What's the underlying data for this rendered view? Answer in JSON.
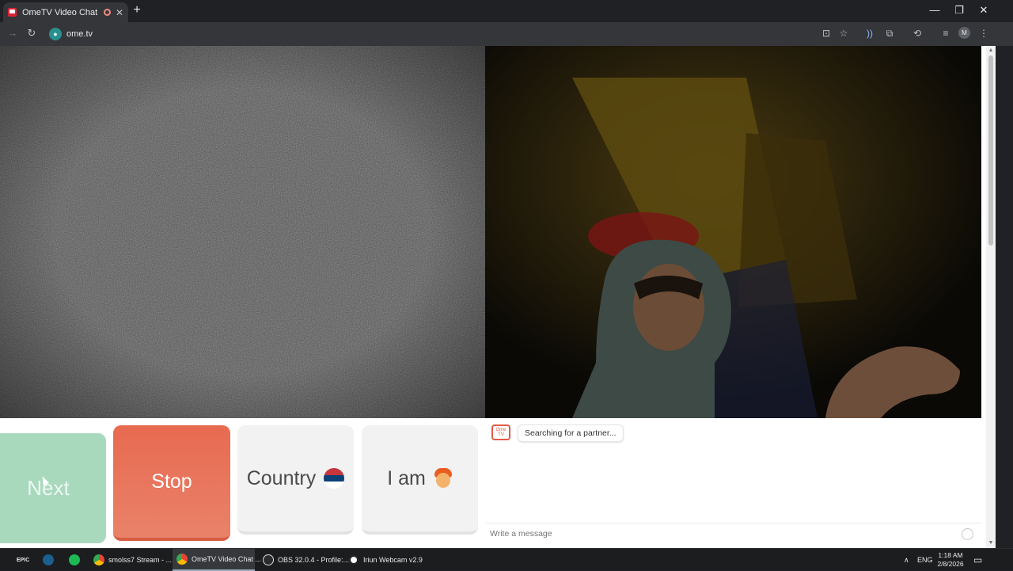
{
  "browser": {
    "tab": {
      "title": "OmeTV Video Chat — Ome",
      "close": "✕"
    },
    "new_tab": "+",
    "window_controls": {
      "minimize": "—",
      "maximize": "❐",
      "close": "✕"
    },
    "nav": {
      "forward": "→",
      "reload": "↻"
    },
    "url": "ome.tv",
    "toolbar_icons": [
      "install-icon",
      "bookmark-star-icon",
      "extension-audio-icon",
      "extensions-icon",
      "history-icon",
      "media-icon"
    ],
    "profile_initial": "M",
    "menu": "⋮"
  },
  "page": {
    "buttons": {
      "next": "Next",
      "stop": "Stop",
      "country": "Country",
      "iam": "I am"
    },
    "country_flag_colors": [
      "#c6363c",
      "#0c4076",
      "#ffffff"
    ],
    "chat": {
      "logo_text": "Ome TV",
      "status": "Searching for a partner...",
      "message_placeholder": "Write a message"
    }
  },
  "taskbar": {
    "items": [
      {
        "label": "",
        "icon": "epic-games-icon"
      },
      {
        "label": "",
        "icon": "steam-icon"
      },
      {
        "label": "",
        "icon": "spotify-icon"
      },
      {
        "label": "smolss7 Stream - ...",
        "icon": "chrome-icon"
      },
      {
        "label": "OmeTV Video Chat ...",
        "icon": "chrome-icon"
      },
      {
        "label": "OBS 32.0.4 - Profile:...",
        "icon": "obs-icon"
      },
      {
        "label": "Iriun Webcam v2.9",
        "icon": "iriun-icon"
      }
    ],
    "epic_label": "EPIC",
    "tray_chevron": "∧",
    "lang": "ENG",
    "time": "1:18 AM",
    "date": "2/8/2026"
  },
  "colors": {
    "stop": "#e86a50",
    "next": "#a8d9bd",
    "neutral_button": "#f2f2f2"
  }
}
